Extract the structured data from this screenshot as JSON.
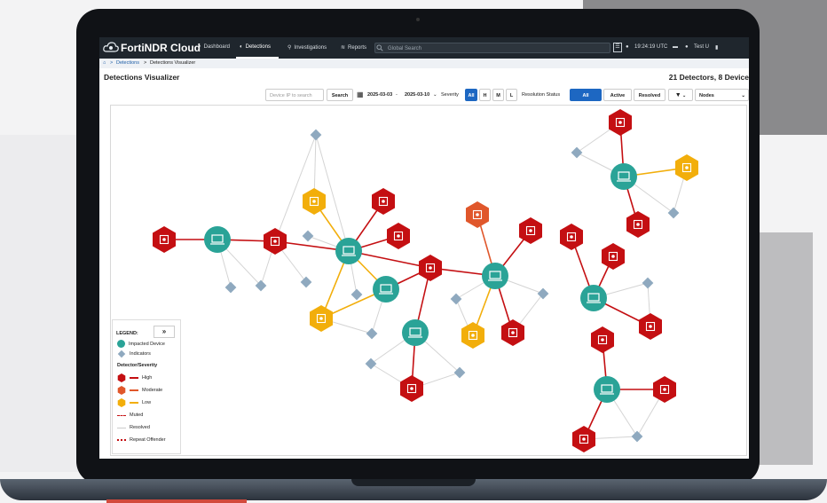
{
  "app": {
    "brand": "FortiNDR Cloud",
    "nav": [
      {
        "label": "Dashboard",
        "icon": "dashboard-icon"
      },
      {
        "label": "Detections",
        "icon": "shield-icon",
        "active": true
      },
      {
        "label": "Investigations",
        "icon": "search-icon"
      },
      {
        "label": "Reports",
        "icon": "reports-icon"
      }
    ],
    "search_placeholder": "Global Search",
    "time": "19:24:19 UTC",
    "user": "Test U"
  },
  "breadcrumb": {
    "home_icon": "home-icon",
    "sep": ">",
    "level1": "Detections",
    "level2": "Detections Visualizer"
  },
  "page": {
    "title": "Detections Visualizer",
    "counts": "21 Detectors, 8 Device"
  },
  "toolbar": {
    "device_placeholder": "Device IP to search",
    "search_label": "Search",
    "date_from": "2025-03-03",
    "date_sep": "-",
    "date_to": "2025-03-10",
    "severity_label": "Severity",
    "severity_options": [
      "All",
      "H",
      "M",
      "L"
    ],
    "severity_selected": "All",
    "resolution_label": "Resolution Status",
    "resolution_options": [
      "All",
      "Active",
      "Resolved"
    ],
    "resolution_selected": "All",
    "view_select": "Nodes"
  },
  "legend": {
    "title": "LEGEND:",
    "expand": "»",
    "impacted_device": "Impacted Device",
    "indicators": "Indicators",
    "section": "Detector/Severity",
    "high": "High",
    "moderate": "Moderate",
    "low": "Low",
    "muted": "Muted",
    "resolved": "Resolved",
    "repeat": "Repeat Offender"
  },
  "colors": {
    "high": "#c40f12",
    "moderate": "#e0572b",
    "low": "#f2ae0b",
    "device": "#2aa397",
    "indicator": "#8fa9bf",
    "accent": "#1d67c2"
  }
}
